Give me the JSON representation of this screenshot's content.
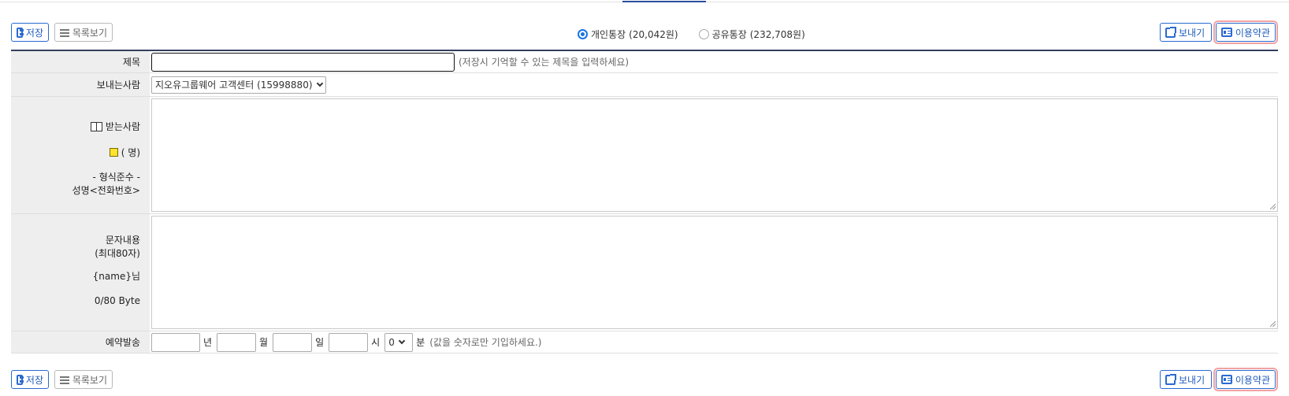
{
  "toolbar": {
    "save_label": "저장",
    "list_label": "목록보기",
    "send_label": "보내기",
    "terms_label": "이용약관"
  },
  "account": {
    "personal_label": "개인통장",
    "personal_amount": "(20,042원)",
    "shared_label": "공유통장",
    "shared_amount": "(232,708원)"
  },
  "form": {
    "title_label": "제목",
    "title_value": "",
    "title_hint": "(저장시 기억할 수 있는 제목을 입력하세요)",
    "sender_label": "보내는사람",
    "sender_value": "지오유그룹웨어 고객센터 (15998880)",
    "recipients_label": "받는사람",
    "recipients_count": "( 명)",
    "format_rule_label": "- 형식준수 -",
    "format_example": "성명<전화번호>",
    "message_label": "문자내용",
    "message_limit": "(최대80자)",
    "name_placeholder": "{name}님",
    "byte_counter": "0/80 Byte",
    "reserve_label": "예약발송",
    "year_unit": "년",
    "month_unit": "월",
    "day_unit": "일",
    "hour_unit": "시",
    "minute_value": "0",
    "minute_unit": "분",
    "reserve_hint": "(값을 숫자로만 기입하세요.)"
  },
  "icons": {
    "save": "save-icon",
    "list": "list-icon",
    "send": "share-icon",
    "terms": "id-card-icon",
    "address_book": "address-book-icon",
    "note": "note-icon"
  }
}
